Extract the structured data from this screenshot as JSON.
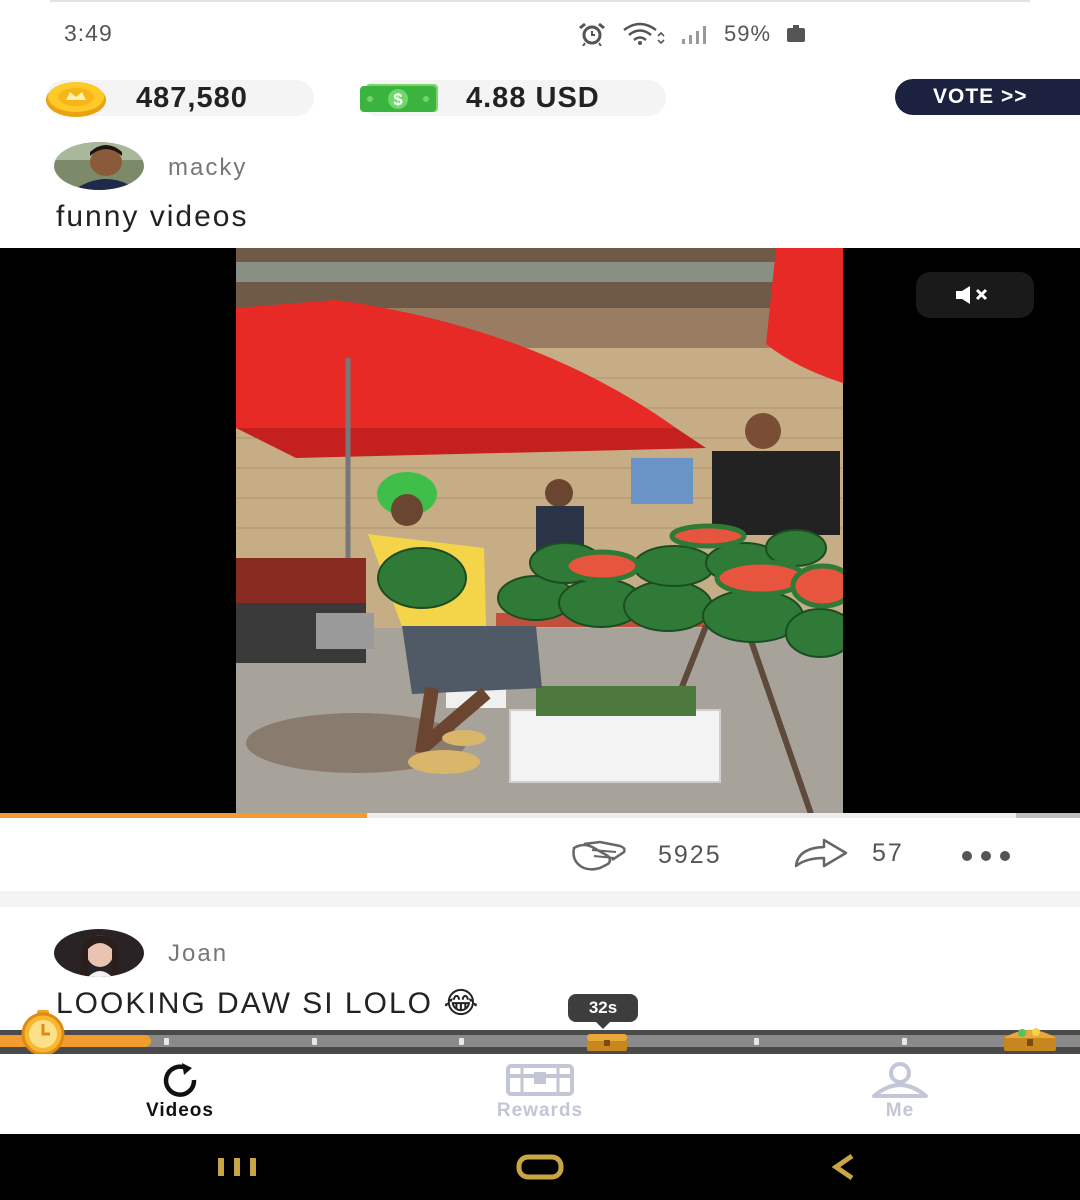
{
  "status_bar": {
    "time": "3:49",
    "battery": "59%",
    "icons": [
      "alarm-icon",
      "wifi-icon",
      "signal-icon",
      "battery-icon"
    ]
  },
  "header": {
    "coins": "487,580",
    "cash": "4.88 USD",
    "vote_label": "VOTE >>"
  },
  "posts": [
    {
      "username": "macky",
      "caption": "funny videos",
      "likes": "5925",
      "shares": "57",
      "progress": 0.34
    },
    {
      "username": "Joan",
      "caption": "LOOKING DAW SI LOLO",
      "emoji": "😂"
    }
  ],
  "timer": {
    "label": "32s",
    "progress": 0.14
  },
  "nav": {
    "videos": "Videos",
    "rewards": "Rewards",
    "me": "Me"
  },
  "colors": {
    "accent": "#f29b2f",
    "vote_bg": "#1d2140",
    "nav_inactive": "#c2c6d6",
    "umbrella": "#e82a26",
    "watermelon": "#2f7a36"
  }
}
